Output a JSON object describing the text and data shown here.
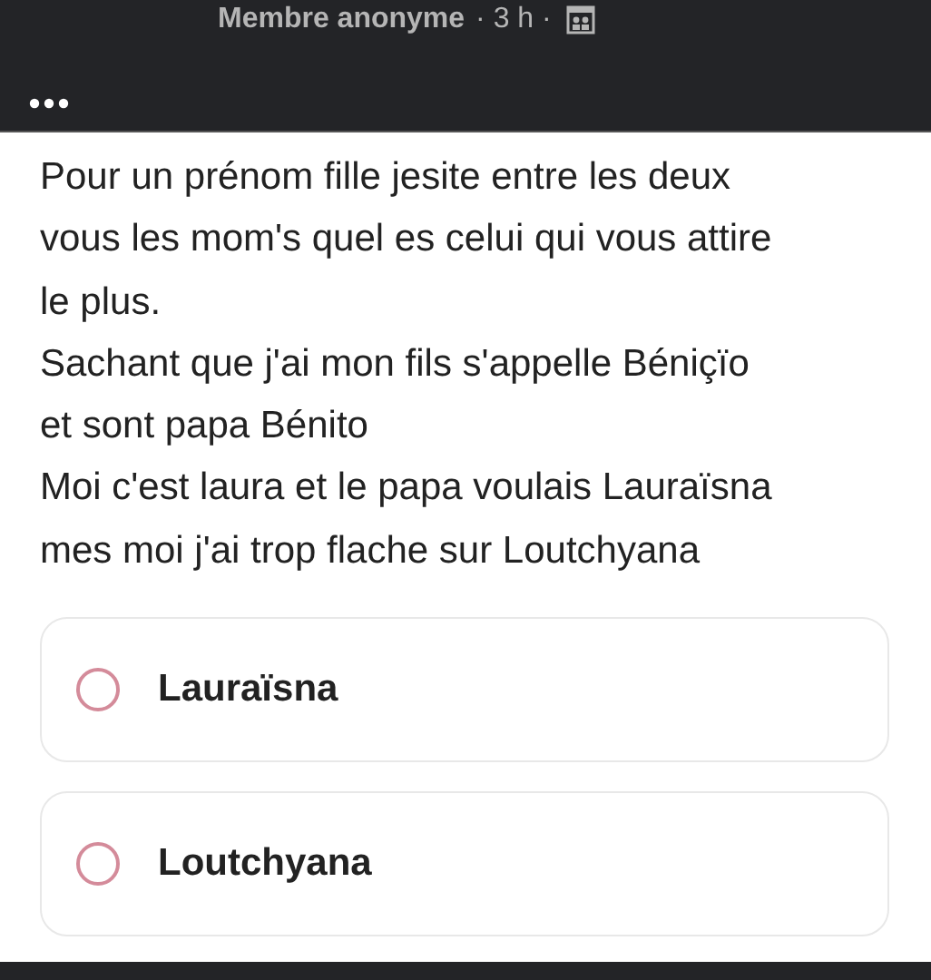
{
  "post": {
    "author": "Membre anonyme",
    "time": "· 3 h ·"
  },
  "body_lines": [
    "Pour un prénom fille jesite entre les deux",
    "vous les mom's quel es celui qui vous attire",
    "le plus.",
    "Sachant que j'ai mon fils s'appelle Béniçïo",
    "et sont papa Bénito",
    "Moi c'est laura et le papa voulais Lauraïsna",
    "mes moi j'ai trop flache sur Loutchyana"
  ],
  "poll_options": [
    {
      "label": "Lauraïsna",
      "selected": false
    },
    {
      "label": "Loutchyana",
      "selected": false
    }
  ]
}
